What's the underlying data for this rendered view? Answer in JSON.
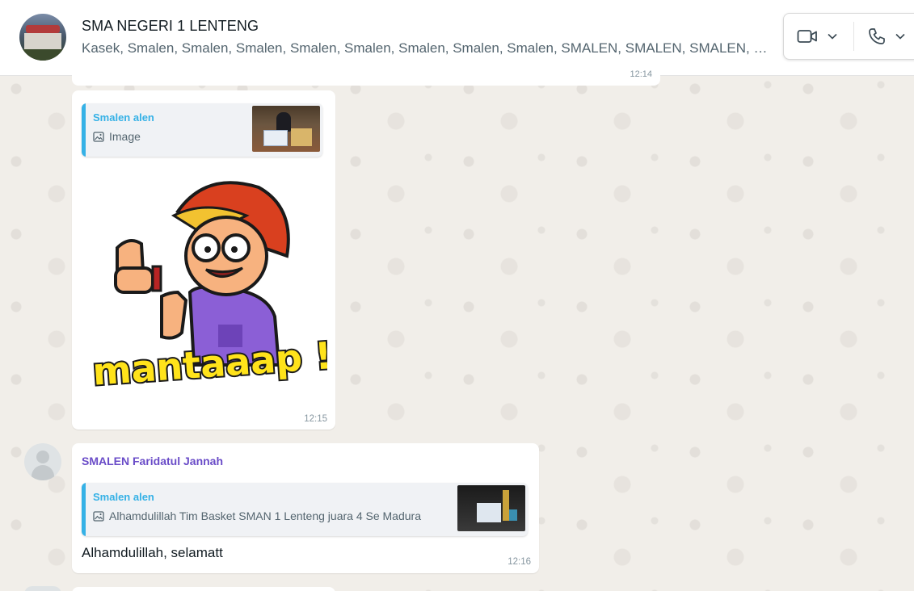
{
  "header": {
    "title": "SMA NEGERI 1 LENTENG",
    "members": "Kasek, Smalen, Smalen, Smalen, Smalen, Smalen, Smalen, Smalen, Smalen, SMALEN, SMALEN, SMALEN, S...",
    "video_icon": "video-camera-icon",
    "voice_icon": "phone-icon"
  },
  "previous_message": {
    "time": "12:14"
  },
  "sticker_message": {
    "quote": {
      "author": "Smalen alen",
      "text": "Image"
    },
    "sticker_text": "mantaaap !",
    "time": "12:15"
  },
  "text_message": {
    "sender": "SMALEN Faridatul Jannah",
    "quote": {
      "author": "Smalen alen",
      "text": "Alhamdulillah Tim Basket SMAN 1 Lenteng juara 4 Se Madura"
    },
    "body": "Alhamdulillah, selamatt",
    "time": "12:16"
  },
  "colors": {
    "quote_accent": "#35b1e6",
    "sender_name": "#6a4cc8"
  }
}
